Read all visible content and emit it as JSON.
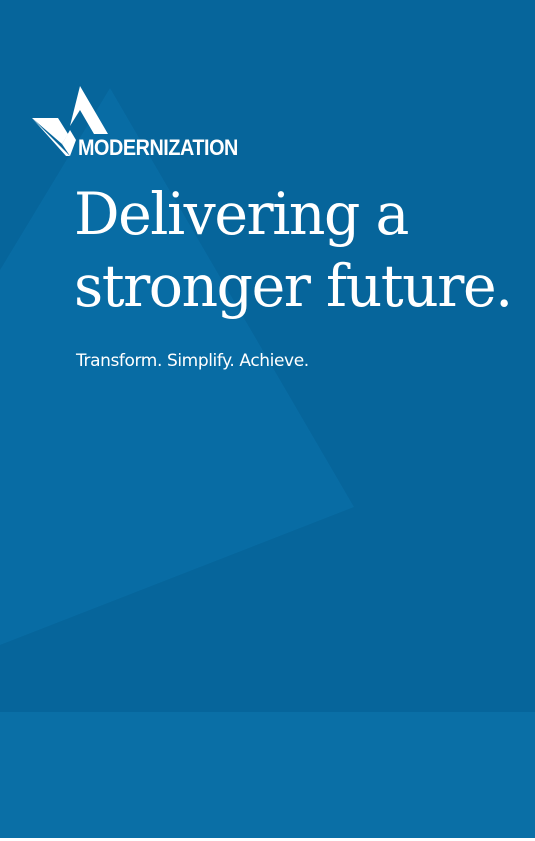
{
  "brand": {
    "logo_text": "MODERNIZATION",
    "logo_icon": "triangle-check-icon"
  },
  "headline": {
    "line1": "Delivering a",
    "line2": "stronger future."
  },
  "tagline": "Transform. Simplify. Achieve.",
  "colors": {
    "background": "#06659b",
    "band": "#0a6fa6",
    "text": "#ffffff"
  }
}
